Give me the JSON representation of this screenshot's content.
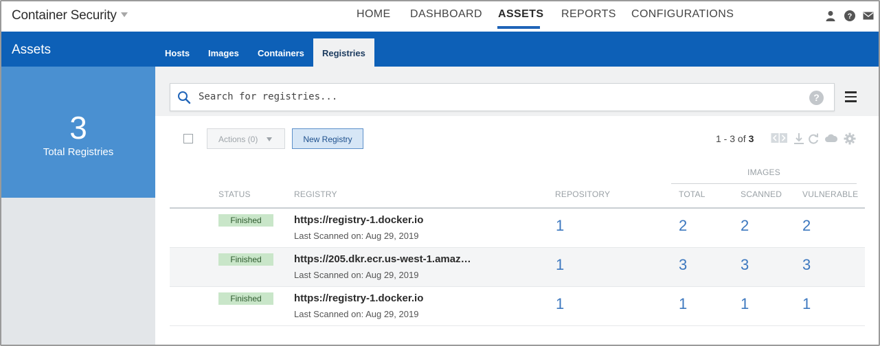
{
  "app": {
    "title": "Container Security"
  },
  "nav": {
    "items": [
      {
        "label": "HOME"
      },
      {
        "label": "DASHBOARD"
      },
      {
        "label": "ASSETS"
      },
      {
        "label": "REPORTS"
      },
      {
        "label": "CONFIGURATIONS"
      }
    ],
    "active": "ASSETS"
  },
  "top_icons": [
    "user-icon",
    "help-icon",
    "mail-icon"
  ],
  "section": {
    "title": "Assets",
    "tabs": [
      {
        "label": "Hosts"
      },
      {
        "label": "Images"
      },
      {
        "label": "Containers"
      },
      {
        "label": "Registries"
      }
    ],
    "active_tab": "Registries"
  },
  "summary": {
    "count": "3",
    "label": "Total Registries"
  },
  "search": {
    "placeholder": "Search for registries...",
    "help_glyph": "?"
  },
  "toolbar": {
    "actions_label": "Actions (0)",
    "new_label": "New Registry",
    "pager_range": "1 - 3 of",
    "pager_total": "3"
  },
  "table": {
    "group_header": "IMAGES",
    "columns": {
      "status": "STATUS",
      "registry": "REGISTRY",
      "repository": "REPOSITORY",
      "total": "TOTAL",
      "scanned": "SCANNED",
      "vulnerable": "VULNERABLE"
    },
    "rows": [
      {
        "status": "Finished",
        "registry": "https://registry-1.docker.io",
        "scanned_on": "Last Scanned on: Aug 29, 2019",
        "repository": "1",
        "total": "2",
        "scanned": "2",
        "vulnerable": "2"
      },
      {
        "status": "Finished",
        "registry": "https://205.dkr.ecr.us-west-1.amaz…",
        "scanned_on": "Last Scanned on: Aug 29, 2019",
        "repository": "1",
        "total": "3",
        "scanned": "3",
        "vulnerable": "3"
      },
      {
        "status": "Finished",
        "registry": "https://registry-1.docker.io",
        "scanned_on": "Last Scanned on: Aug 29, 2019",
        "repository": "1",
        "total": "1",
        "scanned": "1",
        "vulnerable": "1"
      }
    ]
  },
  "colors": {
    "brand_blue": "#0d60b7",
    "card_blue": "#4a90d1",
    "link_blue": "#3d78bf",
    "status_green": "#c9e6c9"
  }
}
